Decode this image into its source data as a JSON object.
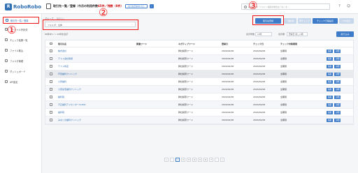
{
  "app": {
    "logo_text": "RoboRobo",
    "logo_mark": "R"
  },
  "header": {
    "title_prefix": "取引先一覧／登録（今月の利用件数",
    "title_quota": "65件／残数（0件）",
    "limit_button": "取引先登録枠を見る",
    "search_placeholder": "取引先名や「ドメイン検索の場合は「@」を…",
    "icons": [
      "help-icon",
      "user-icon"
    ]
  },
  "sidebar": {
    "items": [
      {
        "label": "取引先一覧／登録",
        "icon": "list-icon",
        "active": true
      },
      {
        "label": "ソーシャル外状況",
        "icon": "chart-icon"
      },
      {
        "label": "チェック結果一覧",
        "icon": "check-icon"
      },
      {
        "label": "ファイル取込",
        "icon": "file-icon"
      },
      {
        "label": "フォルダ管理",
        "icon": "folder-icon"
      },
      {
        "label": "ダッシュボード",
        "icon": "dashboard-icon"
      },
      {
        "label": "API設定",
        "icon": "gear-icon"
      }
    ]
  },
  "annotations": {
    "one": "①",
    "two": "②",
    "three": "③"
  },
  "toolbar": {
    "group_label": "グループ",
    "group_value": "指定なし",
    "folder_label": "フォルダ：",
    "folder_value": "全体",
    "register_button": "取引先登録",
    "disabled_button_1": "一括削除",
    "disabled_button_2": "再チェック",
    "check_settings_button": "チェック日程設定",
    "disabled_button_3": "CSV出力",
    "info_line": "66件中 1 ～ 10件を表示",
    "display_count_label": "表示件数",
    "display_count_value": "10件",
    "sort_label": "表示順",
    "sort_value": "登録日 新しい順",
    "export_button": "絞り込み"
  },
  "table": {
    "columns": [
      "取引先名",
      "関連ワード",
      "ネガティブワード",
      "登録日",
      "チェック日",
      "チェック対象期間",
      "",
      ""
    ],
    "rows": [
      {
        "name": "株式会社",
        "neg": "弊社検索ワード",
        "reg": "2024/02/06",
        "chk": "2024/02/06",
        "period": "全期間"
      },
      {
        "name": "テスト会社情報",
        "neg": "弊社検索ワード",
        "reg": "2024/02/06",
        "chk": "2024/02/06",
        "period": "全期間"
      },
      {
        "name": "テスト新店",
        "neg": "弊社検索ワード",
        "reg": "2024/02/06",
        "chk": "2024/02/06",
        "period": "全期間"
      },
      {
        "name": "芦田歯科クリニック",
        "neg": "弊社検索ワード",
        "reg": "2024/02/06",
        "chk": "2024/02/06",
        "period": "全期間"
      },
      {
        "name": "小原歯科",
        "neg": "弊社検索ワード",
        "reg": "2024/02/06",
        "chk": "2024/02/06",
        "period": "全期間"
      },
      {
        "name": "小原在宅歯科クリニック",
        "neg": "弊社検索ワード",
        "reg": "2024/02/06",
        "chk": "2024/02/06",
        "period": "全期間"
      },
      {
        "name": "歯科院",
        "neg": "弊社検索ワード",
        "reg": "2024/02/06",
        "chk": "2024/02/06",
        "period": "全期間"
      },
      {
        "name": "不正歯科アイセンターCLINIC",
        "neg": "弊社検索ワード",
        "reg": "2024/02/06",
        "chk": "2024/02/06",
        "period": "全期間"
      },
      {
        "name": "歯科院",
        "neg": "弊社検索ワード",
        "reg": "2024/02/06",
        "chk": "2024/02/06",
        "period": "全期間"
      },
      {
        "name": "みなとの歯科クリニック",
        "neg": "弊社検索ワード",
        "reg": "2024/02/06",
        "chk": "2024/02/06",
        "period": "全期間"
      }
    ],
    "edit_label": "編集",
    "view_label": "詳細"
  },
  "pagination": [
    "«",
    "‹",
    "1",
    "2",
    "3",
    "4",
    "5",
    "6",
    "7",
    "›",
    "»"
  ]
}
